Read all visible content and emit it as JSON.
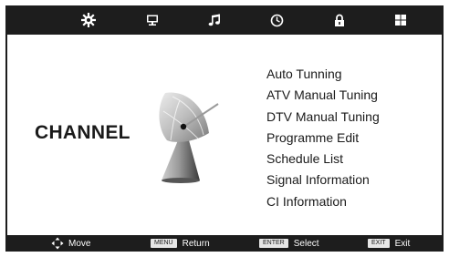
{
  "top_tabs": [
    {
      "icon": "gear-icon",
      "active": true
    },
    {
      "icon": "monitor-icon",
      "active": false
    },
    {
      "icon": "music-note-icon",
      "active": false
    },
    {
      "icon": "clock-icon",
      "active": false
    },
    {
      "icon": "lock-icon",
      "active": false
    },
    {
      "icon": "windows-grid-icon",
      "active": false
    }
  ],
  "section_title": "CHANNEL",
  "section_icon": "satellite-dish-icon",
  "menu_items": [
    "Auto Tunning",
    "ATV Manual Tuning",
    "DTV Manual Tuning",
    "Programme Edit",
    "Schedule List",
    "Signal Information",
    "CI Information"
  ],
  "footer": {
    "move": {
      "icon": "direction-arrows-icon",
      "label": "Move"
    },
    "menu": {
      "key": "MENU",
      "label": "Return"
    },
    "enter": {
      "key": "ENTER",
      "label": "Select"
    },
    "exit": {
      "key": "EXIT",
      "label": "Exit"
    }
  },
  "colors": {
    "bar": "#1d1d1d",
    "background": "#ffffff",
    "text": "#1a1a1a"
  }
}
